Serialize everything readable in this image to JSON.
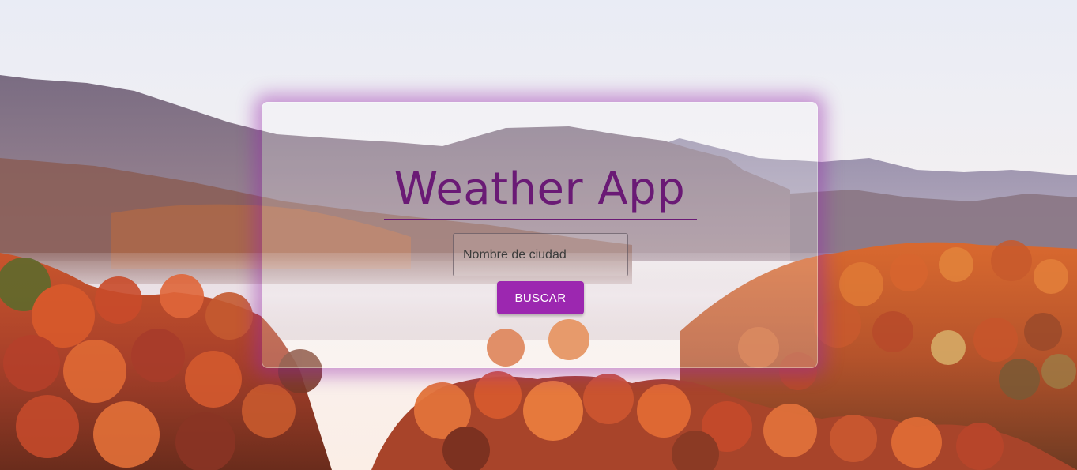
{
  "app": {
    "title": "Weather App"
  },
  "search": {
    "placeholder": "Nombre de ciudad",
    "value": "",
    "button_label": "BUSCAR"
  },
  "background": {
    "description_icon": "autumn-mountain-landscape",
    "colors": {
      "sky_top": "#eceef6",
      "sky_bottom": "#fbf1ec",
      "mountain_far": "#9c90ad",
      "mountain_mid": "#7f6f86",
      "fog": "#e3d5dc",
      "foliage_red": "#c8502a",
      "foliage_orange": "#e0742f",
      "foliage_dark": "#5a2a1d"
    }
  },
  "theme": {
    "accent": "#9c27b0",
    "title_color": "#6a1a75",
    "glow": "#a02cb4"
  }
}
